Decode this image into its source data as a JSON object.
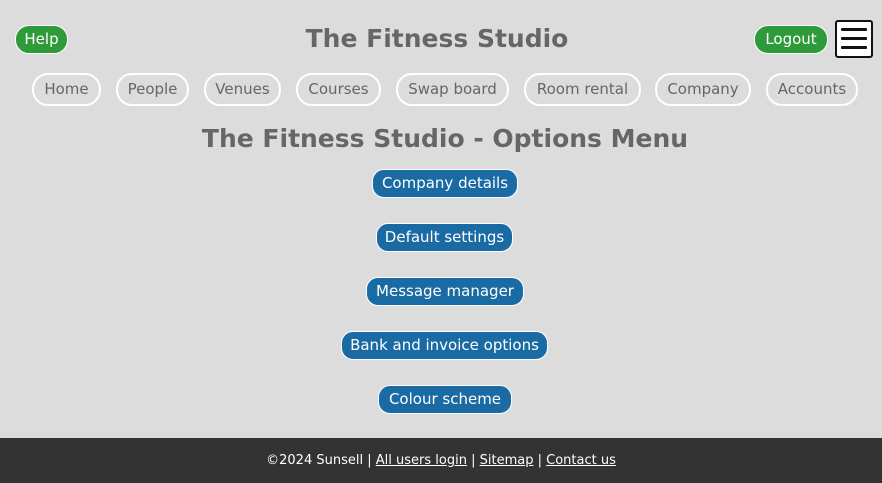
{
  "header": {
    "help_label": "Help",
    "site_title": "The Fitness Studio",
    "logout_label": "Logout"
  },
  "icons": {
    "menu": "hamburger-menu-icon"
  },
  "nav": {
    "items": [
      {
        "label": "Home"
      },
      {
        "label": "People"
      },
      {
        "label": "Venues"
      },
      {
        "label": "Courses"
      },
      {
        "label": "Swap board"
      },
      {
        "label": "Room rental"
      },
      {
        "label": "Company"
      },
      {
        "label": "Accounts"
      }
    ]
  },
  "main": {
    "heading": "The Fitness Studio - Options Menu",
    "options": [
      {
        "label": "Company details"
      },
      {
        "label": "Default settings"
      },
      {
        "label": "Message manager"
      },
      {
        "label": "Bank and invoice options"
      },
      {
        "label": "Colour scheme"
      }
    ]
  },
  "footer": {
    "copyright": "©2024 Sunsell",
    "sep1": "|",
    "link_all_users": "All users login",
    "sep2": "|",
    "link_sitemap": "Sitemap",
    "sep3": "|",
    "link_contact": "Contact us"
  },
  "colors": {
    "background": "#dcdcdc",
    "green_button": "#2e9a3a",
    "blue_button": "#1a6aa4",
    "footer_bg": "#333333",
    "title_text": "#666666"
  }
}
